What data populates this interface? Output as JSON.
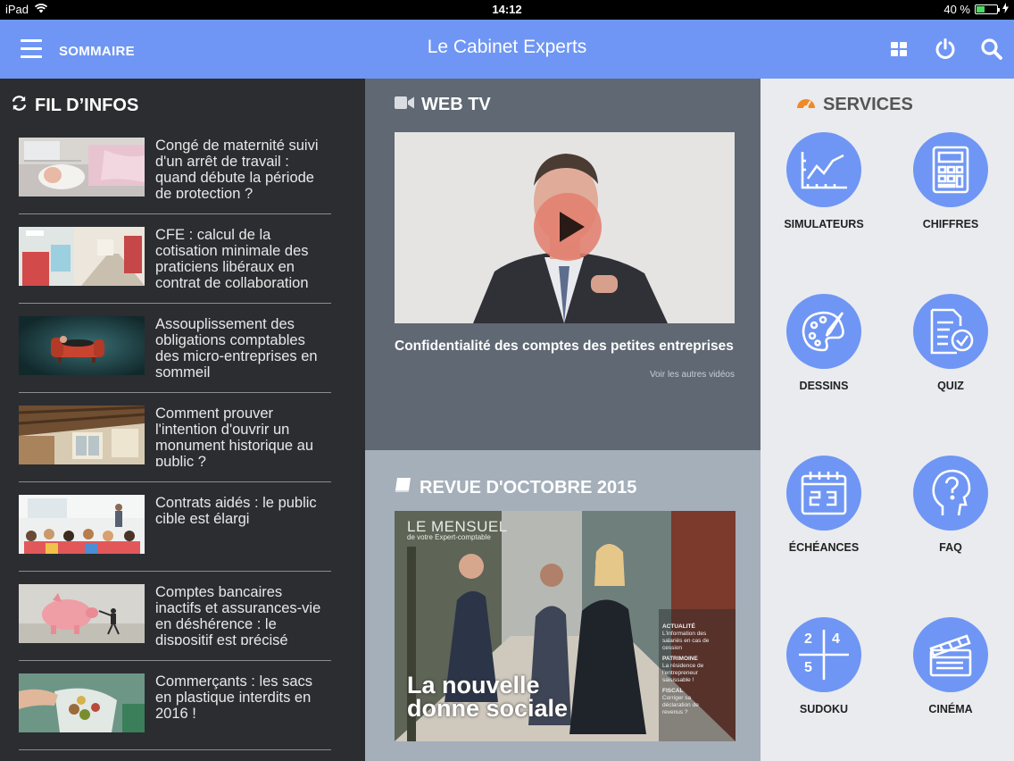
{
  "status_bar": {
    "device": "iPad",
    "time": "14:12",
    "battery": "40 %",
    "battery_level": 0.4
  },
  "navbar": {
    "menu_label": "SOMMAIRE",
    "title": "Le Cabinet Experts"
  },
  "news": {
    "title": "FIL D’INFOS",
    "items": [
      {
        "text": "Congé de maternité suivi d'un arrêt de travail : quand débute la période de protection ?"
      },
      {
        "text": "CFE : calcul de la cotisation minimale des praticiens libéraux en contrat de collaboration"
      },
      {
        "text": "Assouplissement des obligations comptables des micro-entreprises en sommeil"
      },
      {
        "text": "Comment prouver l'intention d'ouvrir un monument historique au public ?"
      },
      {
        "text": "Contrats aidés : le public cible est élargi"
      },
      {
        "text": "Comptes bancaires inactifs et assurances-vie en déshérence : le dispositif est précisé"
      },
      {
        "text": "Commerçants : les sacs en plastique interdits en 2016 !"
      }
    ]
  },
  "webtv": {
    "title": "WEB TV",
    "caption": "Confidentialité des comptes des petites entreprises",
    "more": "Voir les autres vidéos"
  },
  "revue": {
    "title": "REVUE D'OCTOBRE 2015",
    "mag_name": "LE MENSUEL",
    "mag_sub": "de votre Expert-comptable",
    "headline_1": "La nouvelle",
    "headline_2": "donne sociale",
    "side_1_tag": "ACTUALITÉ",
    "side_1_text": "L'information des salariés en cas de cession",
    "side_2_tag": "PATRIMOINE",
    "side_2_text": "La résidence de l'entrepreneur saisissable !",
    "side_3_tag": "FISCAL",
    "side_3_text": "Corriger sa déclaration de revenus ?"
  },
  "services": {
    "title": "SERVICES",
    "items": [
      {
        "label": "SIMULATEURS",
        "icon": "chart-line-icon"
      },
      {
        "label": "CHIFFRES",
        "icon": "calculator-icon"
      },
      {
        "label": "DESSINS",
        "icon": "palette-icon"
      },
      {
        "label": "QUIZ",
        "icon": "checklist-icon"
      },
      {
        "label": "ÉCHÉANCES",
        "icon": "calendar-icon"
      },
      {
        "label": "FAQ",
        "icon": "head-question-icon"
      },
      {
        "label": "SUDOKU",
        "icon": "sudoku-grid-icon",
        "digits": [
          "2",
          "4",
          "5"
        ]
      },
      {
        "label": "CINÉMA",
        "icon": "clapperboard-icon"
      }
    ]
  },
  "colors": {
    "accent": "#6f96f4",
    "news_bg": "#2b2d31",
    "webtv_bg": "#5f6873",
    "revue_bg": "#a5afba",
    "services_bg": "#eaebef",
    "services_icon": "#f08a24"
  }
}
